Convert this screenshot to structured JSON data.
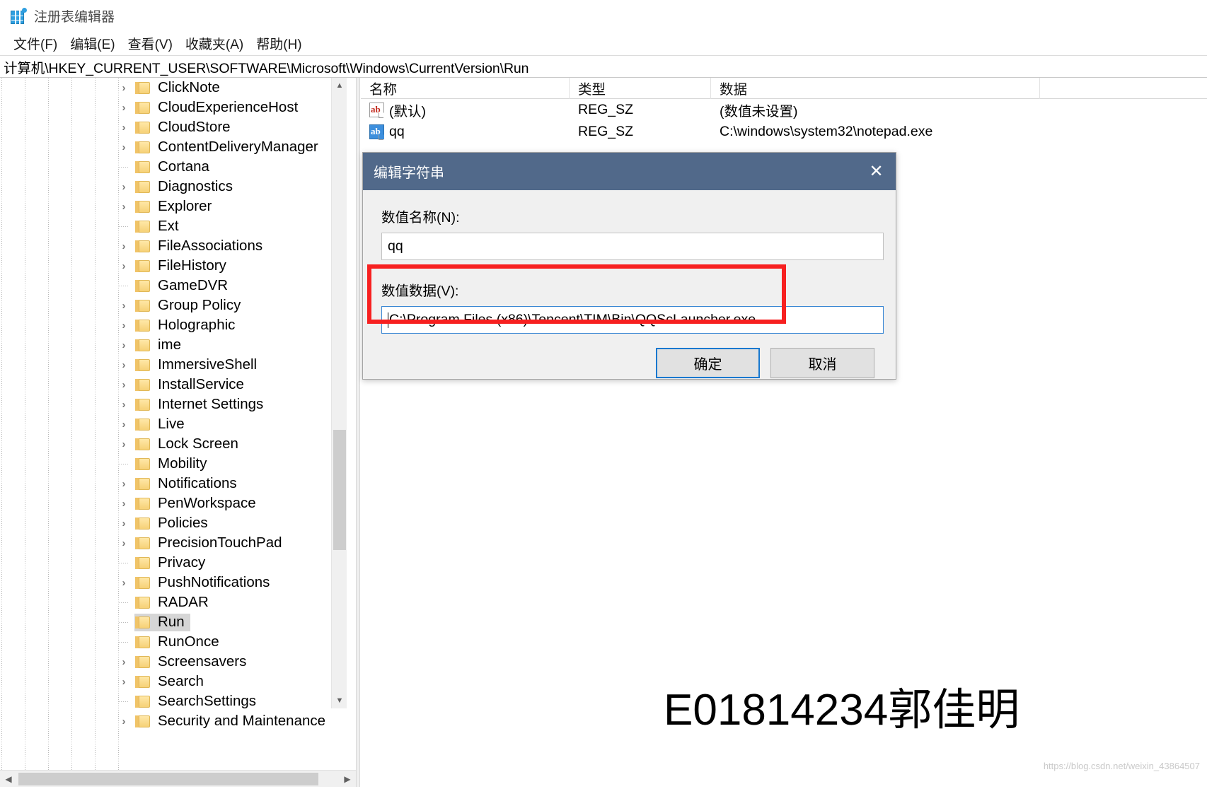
{
  "window": {
    "title": "注册表编辑器",
    "icon": "registry-editor-icon"
  },
  "menu": {
    "items": [
      {
        "label": "文件(F)",
        "name": "menu-file"
      },
      {
        "label": "编辑(E)",
        "name": "menu-edit"
      },
      {
        "label": "查看(V)",
        "name": "menu-view"
      },
      {
        "label": "收藏夹(A)",
        "name": "menu-favorites"
      },
      {
        "label": "帮助(H)",
        "name": "menu-help"
      }
    ]
  },
  "address": {
    "path": "计算机\\HKEY_CURRENT_USER\\SOFTWARE\\Microsoft\\Windows\\CurrentVersion\\Run"
  },
  "tree": {
    "scroll_up_icon": "chevron-up-icon",
    "scroll_down_icon": "chevron-down-icon",
    "hscroll_left_icon": "chevron-left-icon",
    "hscroll_right_icon": "chevron-right-icon",
    "items": [
      {
        "label": "ClickNote",
        "expandable": true,
        "selected": false
      },
      {
        "label": "CloudExperienceHost",
        "expandable": true,
        "selected": false
      },
      {
        "label": "CloudStore",
        "expandable": true,
        "selected": false
      },
      {
        "label": "ContentDeliveryManager",
        "expandable": true,
        "selected": false
      },
      {
        "label": "Cortana",
        "expandable": false,
        "selected": false
      },
      {
        "label": "Diagnostics",
        "expandable": true,
        "selected": false
      },
      {
        "label": "Explorer",
        "expandable": true,
        "selected": false
      },
      {
        "label": "Ext",
        "expandable": false,
        "selected": false
      },
      {
        "label": "FileAssociations",
        "expandable": true,
        "selected": false
      },
      {
        "label": "FileHistory",
        "expandable": true,
        "selected": false
      },
      {
        "label": "GameDVR",
        "expandable": false,
        "selected": false
      },
      {
        "label": "Group Policy",
        "expandable": true,
        "selected": false
      },
      {
        "label": "Holographic",
        "expandable": true,
        "selected": false
      },
      {
        "label": "ime",
        "expandable": true,
        "selected": false
      },
      {
        "label": "ImmersiveShell",
        "expandable": true,
        "selected": false
      },
      {
        "label": "InstallService",
        "expandable": true,
        "selected": false
      },
      {
        "label": "Internet Settings",
        "expandable": true,
        "selected": false
      },
      {
        "label": "Live",
        "expandable": true,
        "selected": false
      },
      {
        "label": "Lock Screen",
        "expandable": true,
        "selected": false
      },
      {
        "label": "Mobility",
        "expandable": false,
        "selected": false
      },
      {
        "label": "Notifications",
        "expandable": true,
        "selected": false
      },
      {
        "label": "PenWorkspace",
        "expandable": true,
        "selected": false
      },
      {
        "label": "Policies",
        "expandable": true,
        "selected": false
      },
      {
        "label": "PrecisionTouchPad",
        "expandable": true,
        "selected": false
      },
      {
        "label": "Privacy",
        "expandable": false,
        "selected": false
      },
      {
        "label": "PushNotifications",
        "expandable": true,
        "selected": false
      },
      {
        "label": "RADAR",
        "expandable": false,
        "selected": false
      },
      {
        "label": "Run",
        "expandable": false,
        "selected": true
      },
      {
        "label": "RunOnce",
        "expandable": false,
        "selected": false
      },
      {
        "label": "Screensavers",
        "expandable": true,
        "selected": false
      },
      {
        "label": "Search",
        "expandable": true,
        "selected": false
      },
      {
        "label": "SearchSettings",
        "expandable": false,
        "selected": false
      },
      {
        "label": "Security and Maintenance",
        "expandable": true,
        "selected": false
      }
    ]
  },
  "values_list": {
    "columns": [
      "名称",
      "类型",
      "数据"
    ],
    "rows": [
      {
        "icon": "string-value-icon",
        "name": "(默认)",
        "type": "REG_SZ",
        "data": "(数值未设置)",
        "selected": false
      },
      {
        "icon": "string-value-icon",
        "name": "qq",
        "type": "REG_SZ",
        "data": "C:\\windows\\system32\\notepad.exe",
        "selected": true
      }
    ]
  },
  "dialog": {
    "title": "编辑字符串",
    "close_icon": "close-icon",
    "name_label": "数值名称(N):",
    "name_value": "qq",
    "data_label": "数值数据(V):",
    "data_value": "C:\\Program Files (x86)\\Tencent\\TIM\\Bin\\QQScLauncher.exe",
    "ok_label": "确定",
    "cancel_label": "取消"
  },
  "annotation": {
    "red_box_color": "#f72020",
    "overlay_text": "E01814234郭佳明",
    "watermark": "https://blog.csdn.net/weixin_43864507"
  },
  "colors": {
    "dialog_titlebar": "#51698a",
    "focus_blue": "#1878cf",
    "selection_gray": "#d6d6d6",
    "folder_yellow": "#f6d177"
  }
}
